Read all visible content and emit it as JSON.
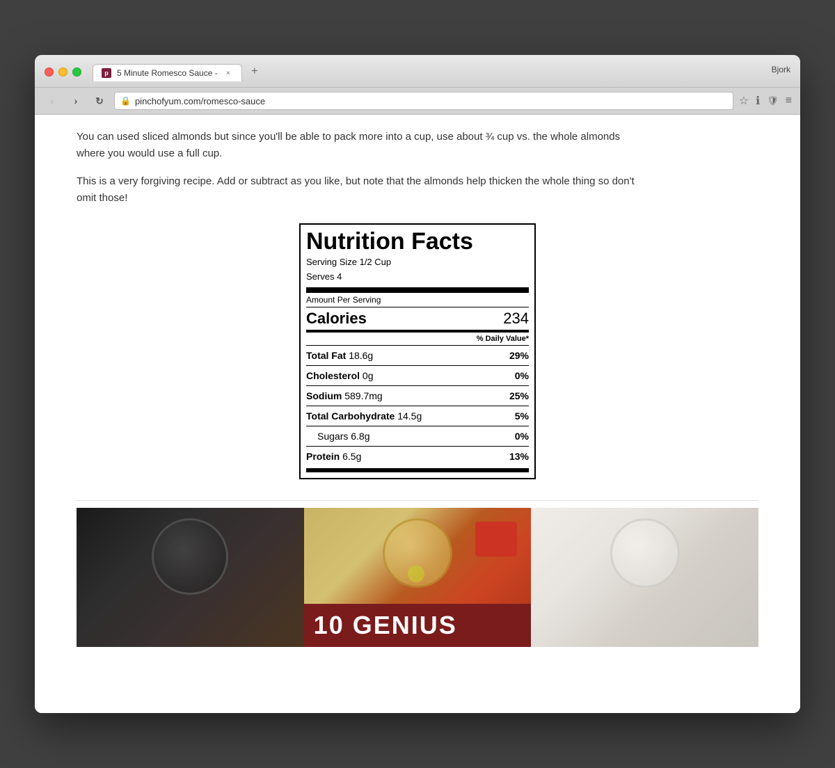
{
  "browser": {
    "tab_favicon": "p",
    "tab_title": "5 Minute Romesco Sauce -",
    "tab_close": "×",
    "new_tab": "+",
    "user_name": "Bjork",
    "nav_back": "‹",
    "nav_forward": "›",
    "nav_reload": "↻",
    "address": "pinchofyum.com/romesco-sauce",
    "toolbar": {
      "star": "☆",
      "info": "ℹ",
      "shield": "🛡",
      "menu": "≡"
    }
  },
  "article": {
    "paragraph1": "You can used sliced almonds but since you'll be able to pack more into a cup, use about ¾ cup vs. the whole almonds where you would use a full cup.",
    "paragraph2": "This is a very forgiving recipe. Add or subtract as you like, but note that the almonds help thicken the whole thing so don't omit those!"
  },
  "nutrition": {
    "title": "Nutrition Facts",
    "serving_size_label": "Serving Size 1/2 Cup",
    "serves_label": "Serves 4",
    "amount_per_serving": "Amount Per Serving",
    "calories_label": "Calories",
    "calories_value": "234",
    "daily_value_header": "% Daily Value*",
    "nutrients": [
      {
        "name": "Total Fat",
        "amount": "18.6g",
        "percent": "29%",
        "bold": true
      },
      {
        "name": "Cholesterol",
        "amount": "0g",
        "percent": "0%",
        "bold": true
      },
      {
        "name": "Sodium",
        "amount": "589.7mg",
        "percent": "25%",
        "bold": true
      },
      {
        "name": "Total Carbohydrate",
        "amount": "14.5g",
        "percent": "5%",
        "bold": true
      },
      {
        "name": "Sugars",
        "amount": "6.8g",
        "percent": "0%",
        "bold": false,
        "indented": true
      },
      {
        "name": "Protein",
        "amount": "6.5g",
        "percent": "13%",
        "bold": true
      }
    ]
  },
  "bottom_banner": {
    "text": "10 GENIUS"
  }
}
